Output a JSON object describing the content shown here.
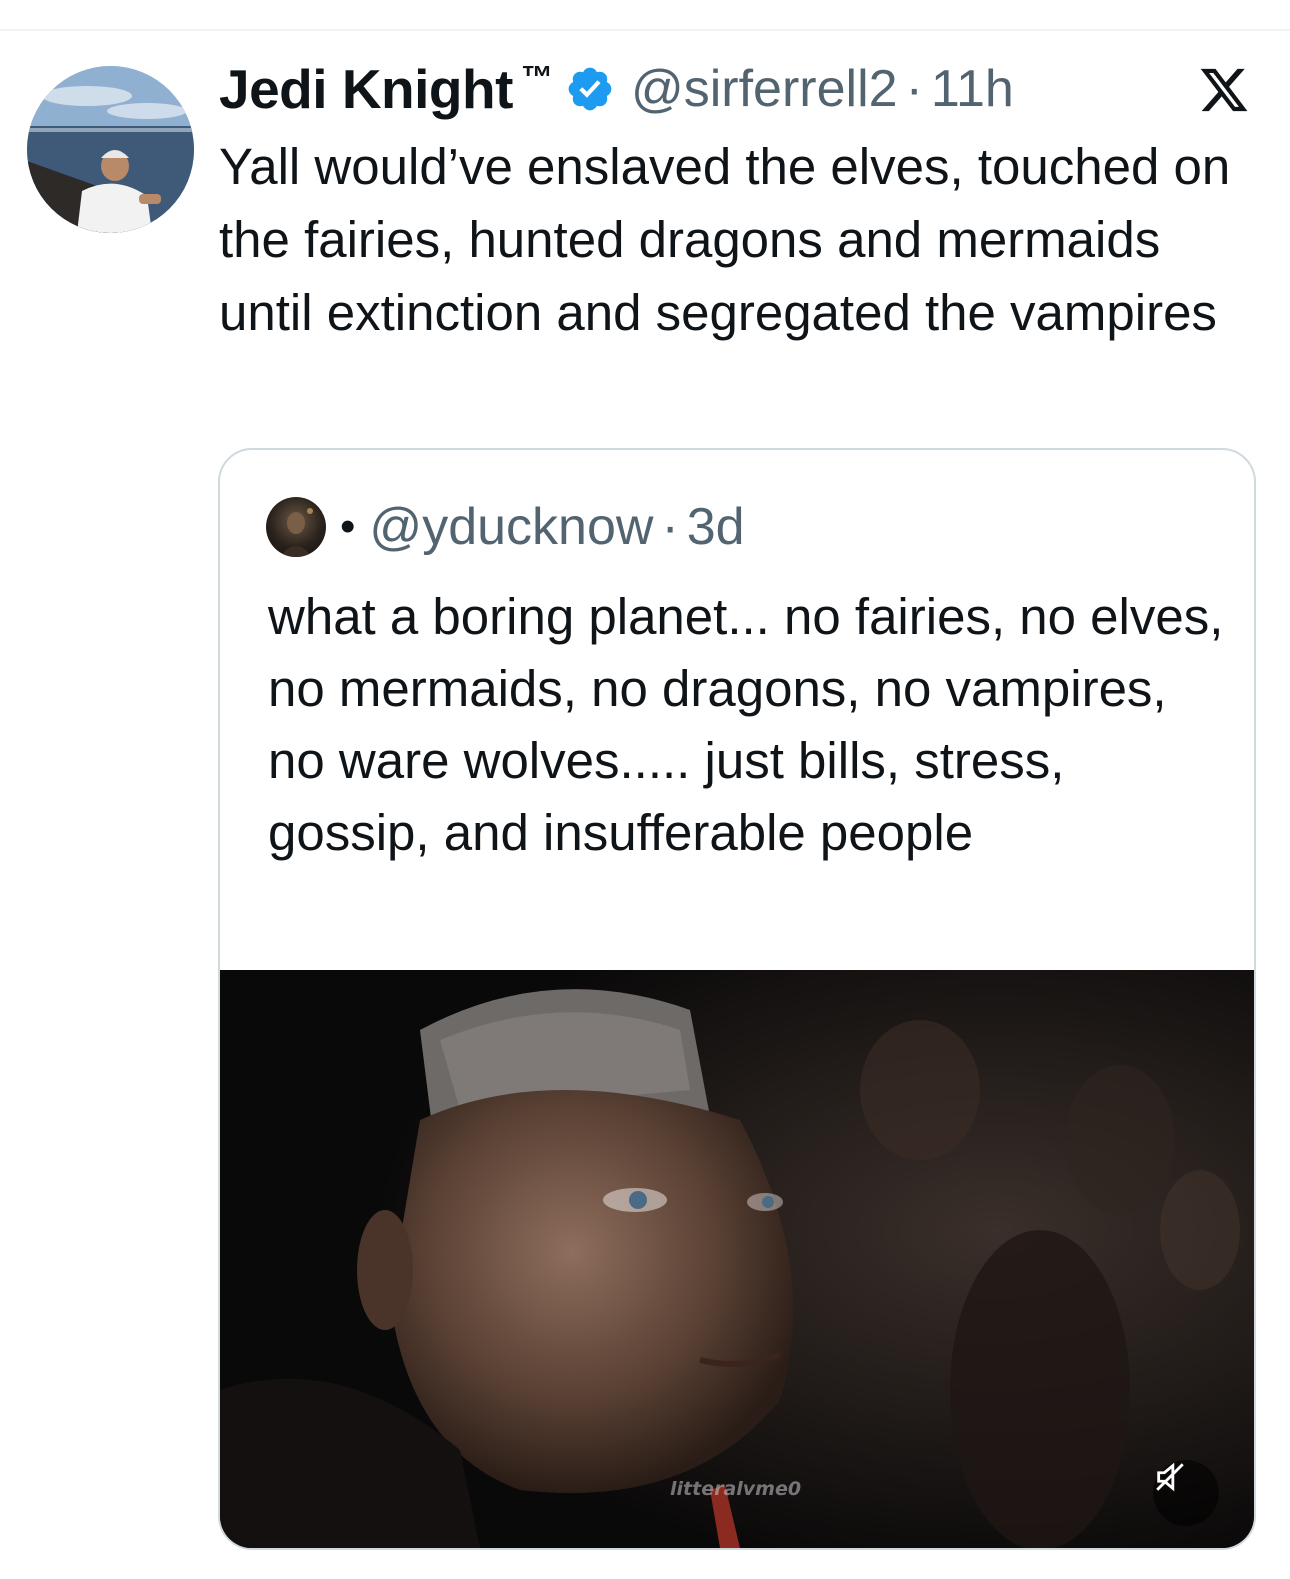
{
  "tweet": {
    "display_name": "Jedi Knight",
    "trademark": "™",
    "handle": "@sirferrell2",
    "separator": "·",
    "time": "11h",
    "text": "Yall would’ve enslaved the elves, touched on the fairies, hunted dragons and mermaids until extinction and segregated the vampires",
    "verified_icon": "verified-badge-icon",
    "platform_icon": "x-logo-icon"
  },
  "quote": {
    "bullet": "•",
    "handle": "@yducknow",
    "separator": "·",
    "time": "3d",
    "text": "what a boring planet... no fairies, no elves, no mermaids, no dragons, no vampires, no ware wolves..... just bills, stress, gossip, and insufferable people",
    "media": {
      "watermark": "litteralvme0",
      "mute_icon": "speaker-muted-icon"
    }
  },
  "colors": {
    "text": "#0f1419",
    "secondary": "#536471",
    "verified": "#1d9bf0",
    "border": "#cfd9de"
  }
}
